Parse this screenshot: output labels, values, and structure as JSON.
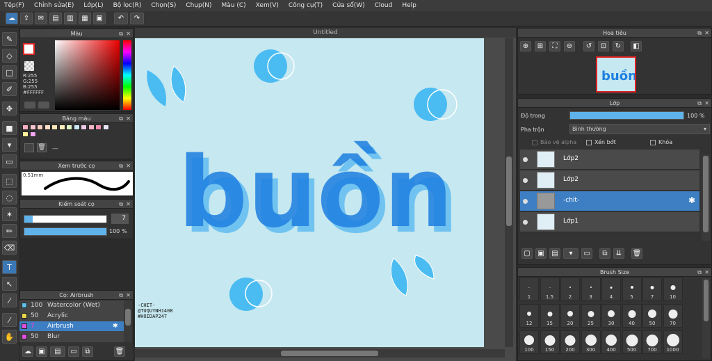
{
  "menu": [
    "Tệp(F)",
    "Chỉnh sửa(E)",
    "Lớp(L)",
    "Bộ lọc(R)",
    "Chọn(S)",
    "Chụp(N)",
    "Màu (C)",
    "Xem(V)",
    "Công cụ(T)",
    "Cửa sổ(W)",
    "Cloud",
    "Help"
  ],
  "canvas": {
    "tab_title": "Untitled",
    "artwork_text": "buồn",
    "signature": [
      "-CHIT-",
      "@TUQUYNH1408",
      "#HOIDAP247"
    ]
  },
  "color_panel": {
    "title": "Màu",
    "r": "R:255",
    "g": "G:255",
    "b": "B:255",
    "hex": "#FFFFFF"
  },
  "palette_panel": {
    "title": "Bảng màu",
    "dashes": "---"
  },
  "preview_panel": {
    "title": "Xem trước cọ",
    "size": "0.51mm"
  },
  "brush_control": {
    "title": "Kiểm soát cọ",
    "size_value": "7",
    "opacity_value": "100 %"
  },
  "brush_panel": {
    "title": "Cọ: Airbrush",
    "items": [
      {
        "value": "100",
        "name": "Watercolor (Wet)",
        "color": "#5fc0e8"
      },
      {
        "value": "50",
        "name": "Acrylic",
        "color": "#e8d84a"
      },
      {
        "value": "7",
        "name": "Airbrush",
        "color": "#e050e0"
      },
      {
        "value": "50",
        "name": "Blur",
        "color": "#e050e0"
      }
    ]
  },
  "navigator": {
    "title": "Hoa tiêu"
  },
  "layer_panel": {
    "title": "Lớp",
    "opacity_label": "Độ trong",
    "opacity_value": "100 %",
    "blend_label": "Pha trộn",
    "blend_value": "Bình thường",
    "alpha_label": "Bảo vệ alpha",
    "clip_label": "Xén bớt",
    "lock_label": "Khóa",
    "layers": [
      "Lớp2",
      "Lớp2",
      "-chit-",
      "Lớp1"
    ]
  },
  "brush_size": {
    "title": "Brush Size",
    "sizes": [
      "1",
      "1.5",
      "2",
      "3",
      "4",
      "5",
      "7",
      "10",
      "12",
      "15",
      "20",
      "25",
      "30",
      "40",
      "50",
      "70",
      "100",
      "150",
      "200",
      "300",
      "400",
      "500",
      "700",
      "1000"
    ]
  }
}
